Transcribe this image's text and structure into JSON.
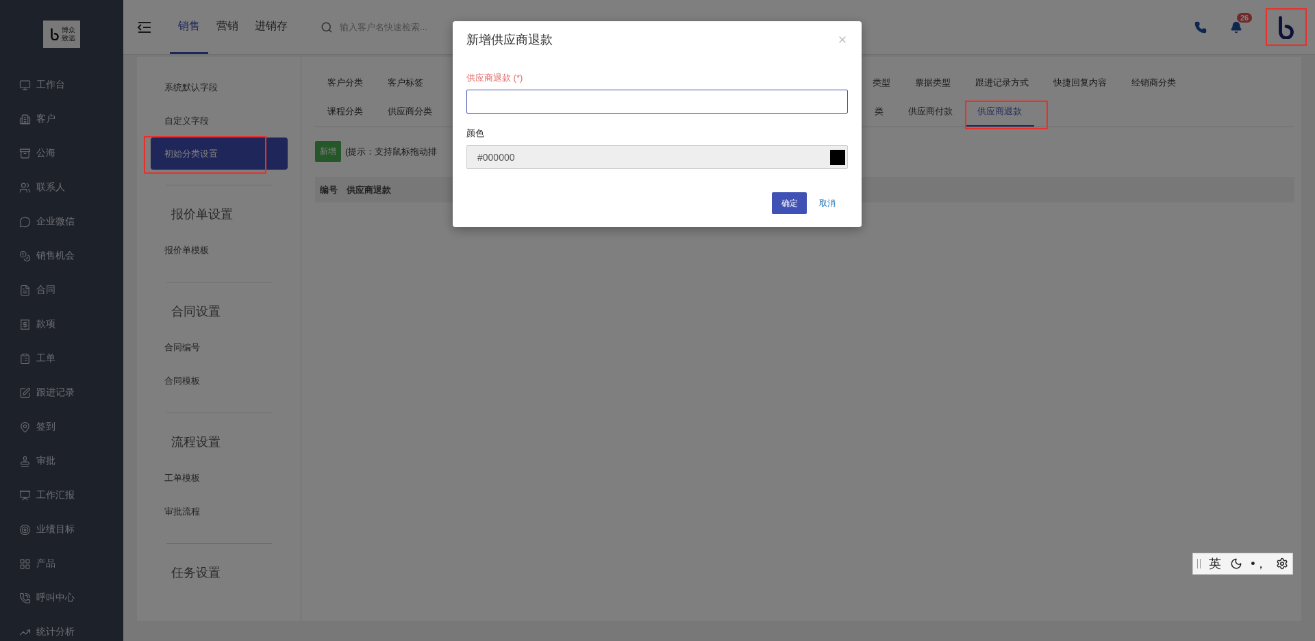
{
  "sidebar": {
    "logo": {
      "line_1": "博众",
      "line_2": "致远"
    },
    "items": [
      {
        "label": "工作台"
      },
      {
        "label": "客户"
      },
      {
        "label": "公海"
      },
      {
        "label": "联系人"
      },
      {
        "label": "企业微信"
      },
      {
        "label": "销售机会"
      },
      {
        "label": "合同"
      },
      {
        "label": "款项"
      },
      {
        "label": "工单"
      },
      {
        "label": "跟进记录"
      },
      {
        "label": "签到"
      },
      {
        "label": "审批"
      },
      {
        "label": "工作汇报"
      },
      {
        "label": "业绩目标"
      },
      {
        "label": "产品"
      },
      {
        "label": "呼叫中心"
      },
      {
        "label": "统计分析"
      }
    ]
  },
  "top_bar": {
    "tabs": [
      {
        "label": "销售",
        "selected": true
      },
      {
        "label": "营销",
        "selected": false
      },
      {
        "label": "进销存",
        "selected": false
      }
    ],
    "search": {
      "placeholder": "输入客户名快速检索..."
    },
    "notifications": {
      "badge": "26"
    },
    "brand_logo": {
      "highlighted": true
    }
  },
  "settings_menu": {
    "sections": [
      {
        "items": [
          {
            "label": "系统默认字段",
            "selected": false,
            "highlighted": false
          },
          {
            "label": "自定义字段",
            "selected": false,
            "highlighted": false
          },
          {
            "label": "初始分类设置",
            "selected": true,
            "highlighted": true
          }
        ]
      },
      {
        "heading": "报价单设置",
        "items": [
          {
            "label": "报价单模板",
            "selected": false,
            "highlighted": false
          }
        ]
      },
      {
        "heading": "合同设置",
        "items": [
          {
            "label": "合同编号",
            "selected": false,
            "highlighted": false
          },
          {
            "label": "合同模板",
            "selected": false,
            "highlighted": false
          }
        ]
      },
      {
        "heading": "流程设置",
        "items": [
          {
            "label": "工单模板",
            "selected": false,
            "highlighted": false
          },
          {
            "label": "审批流程",
            "selected": false,
            "highlighted": false
          }
        ]
      },
      {
        "heading": "任务设置"
      }
    ]
  },
  "category_tabs": {
    "rows": [
      {
        "left": [
          {
            "label": "客户分类",
            "selected": false,
            "highlighted": false
          },
          {
            "label": "客户标签",
            "selected": false,
            "highlighted": false
          }
        ],
        "right": [
          {
            "label": "类型",
            "selected": false,
            "highlighted": false
          },
          {
            "label": "票据类型",
            "selected": false,
            "highlighted": false
          },
          {
            "label": "跟进记录方式",
            "selected": false,
            "highlighted": false
          },
          {
            "label": "快捷回复内容",
            "selected": false,
            "highlighted": false
          },
          {
            "label": "经销商分类",
            "selected": false,
            "highlighted": false
          }
        ]
      },
      {
        "left": [
          {
            "label": "课程分类",
            "selected": false,
            "highlighted": false
          },
          {
            "label": "供应商分类",
            "selected": false,
            "highlighted": false
          }
        ],
        "right": [
          {
            "label": "类",
            "selected": false,
            "highlighted": false
          },
          {
            "label": "供应商付款",
            "selected": false,
            "highlighted": false
          },
          {
            "label": "供应商退款",
            "selected": true,
            "highlighted": true
          }
        ]
      }
    ]
  },
  "toolbar": {
    "add_button": "新增",
    "hint": "(提示：支持鼠标拖动排"
  },
  "table": {
    "columns": [
      "编号",
      "供应商退款"
    ]
  },
  "dialog": {
    "title": "新增供应商退款",
    "fields": [
      {
        "kind": "text",
        "label": "供应商退款 (*)",
        "required": true
      },
      {
        "kind": "color",
        "label": "颜色",
        "required": false,
        "value": "#000000",
        "color": "#000000"
      }
    ],
    "confirm": "确定",
    "cancel": "取消"
  },
  "ime_toolbar": {
    "language": "英",
    "punctuation": "•，"
  }
}
